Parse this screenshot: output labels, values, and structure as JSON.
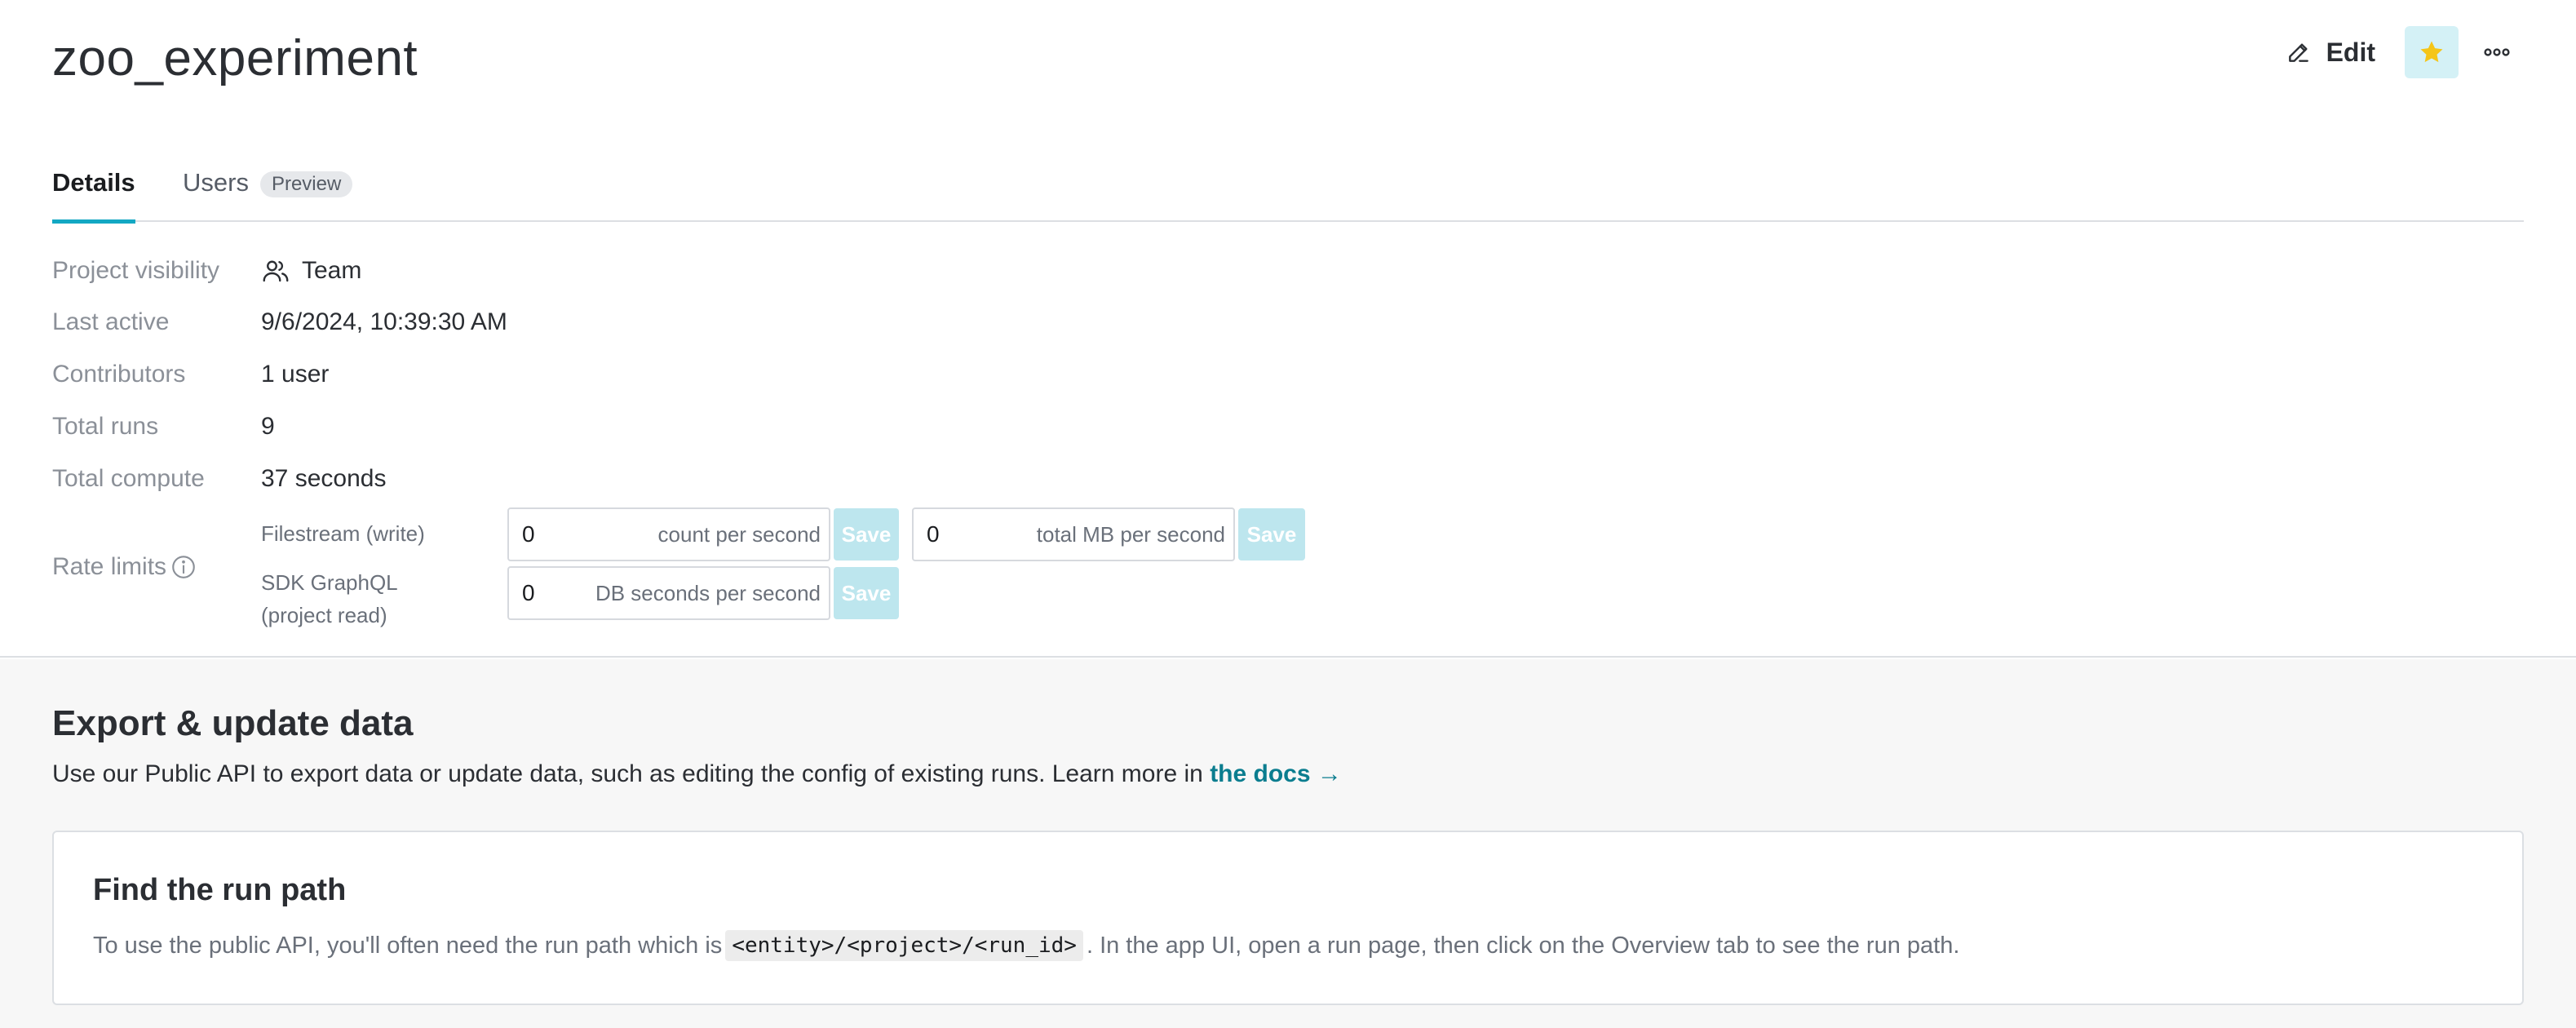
{
  "header": {
    "title": "zoo_experiment",
    "edit_label": "Edit",
    "starred": true
  },
  "tabs": [
    {
      "label": "Details",
      "active": true
    },
    {
      "label": "Users",
      "badge": "Preview",
      "active": false
    }
  ],
  "details": {
    "project_visibility": {
      "label": "Project visibility",
      "value": "Team",
      "icon": "team-icon"
    },
    "last_active": {
      "label": "Last active",
      "value": "9/6/2024, 10:39:30 AM"
    },
    "contributors": {
      "label": "Contributors",
      "value": "1 user"
    },
    "total_runs": {
      "label": "Total runs",
      "value": "9"
    },
    "total_compute": {
      "label": "Total compute",
      "value": "37 seconds"
    }
  },
  "rate_limits": {
    "label": "Rate limits",
    "filestream": {
      "name": "Filestream (write)",
      "count_value": "0",
      "count_unit": "count per second",
      "mb_value": "0",
      "mb_unit": "total MB per second"
    },
    "graphql": {
      "name_line1": "SDK GraphQL",
      "name_line2": "(project read)",
      "value": "0",
      "unit": "DB seconds per second"
    },
    "save_label": "Save"
  },
  "export": {
    "title": "Export & update data",
    "description": "Use our Public API to export data or update data, such as editing the config of existing runs. Learn more in",
    "docs_link": "the docs →",
    "card": {
      "title": "Find the run path",
      "text_before": "To use the public API, you'll often need the run path which is",
      "code": "<entity>/<project>/<run_id>",
      "text_after": ". In the app UI, open a run page, then click on the Overview tab to see the run path."
    }
  },
  "colors": {
    "accent": "#13a8c3",
    "star": "#f5c518",
    "link": "#0b7d8f",
    "save_disabled": "#bde6ee"
  }
}
